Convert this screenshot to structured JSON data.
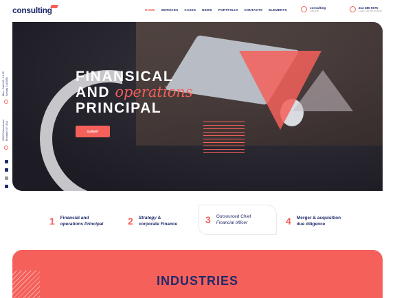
{
  "logo": "consulting",
  "nav": [
    "HOME",
    "SERVICES",
    "CASES",
    "NEWS",
    "PORTFOLIO",
    "CONTACTS",
    "ELEMENTS"
  ],
  "contact_skype": {
    "title": "consulting",
    "sub": "ONLINE"
  },
  "contact_phone": {
    "title": "212 386 5575",
    "sub": "CALL OR MESSAGE"
  },
  "sidebar": {
    "hours": "Mon - Sat 8:00 - 18:00 Sunday CLOSED",
    "address": "1012 Fairbrook ave Brooklyn NY, USA"
  },
  "hero": {
    "line1": "FINANSICAL",
    "line2a": "AND ",
    "line2b": "operations",
    "line3": "PRINCIPAL",
    "button": "SUBMIT"
  },
  "features": [
    {
      "num": "1",
      "a": "Financial and",
      "b": "operations Principal"
    },
    {
      "num": "2",
      "a": "Strategy",
      "a2": " &",
      "b": "corporate Finance"
    },
    {
      "num": "3",
      "a": "Outsourced Chief",
      "b": "Financial officer"
    },
    {
      "num": "4",
      "a": "Merger & acquisition",
      "b": "due diligence"
    }
  ],
  "industries": "INDUSTRIES"
}
